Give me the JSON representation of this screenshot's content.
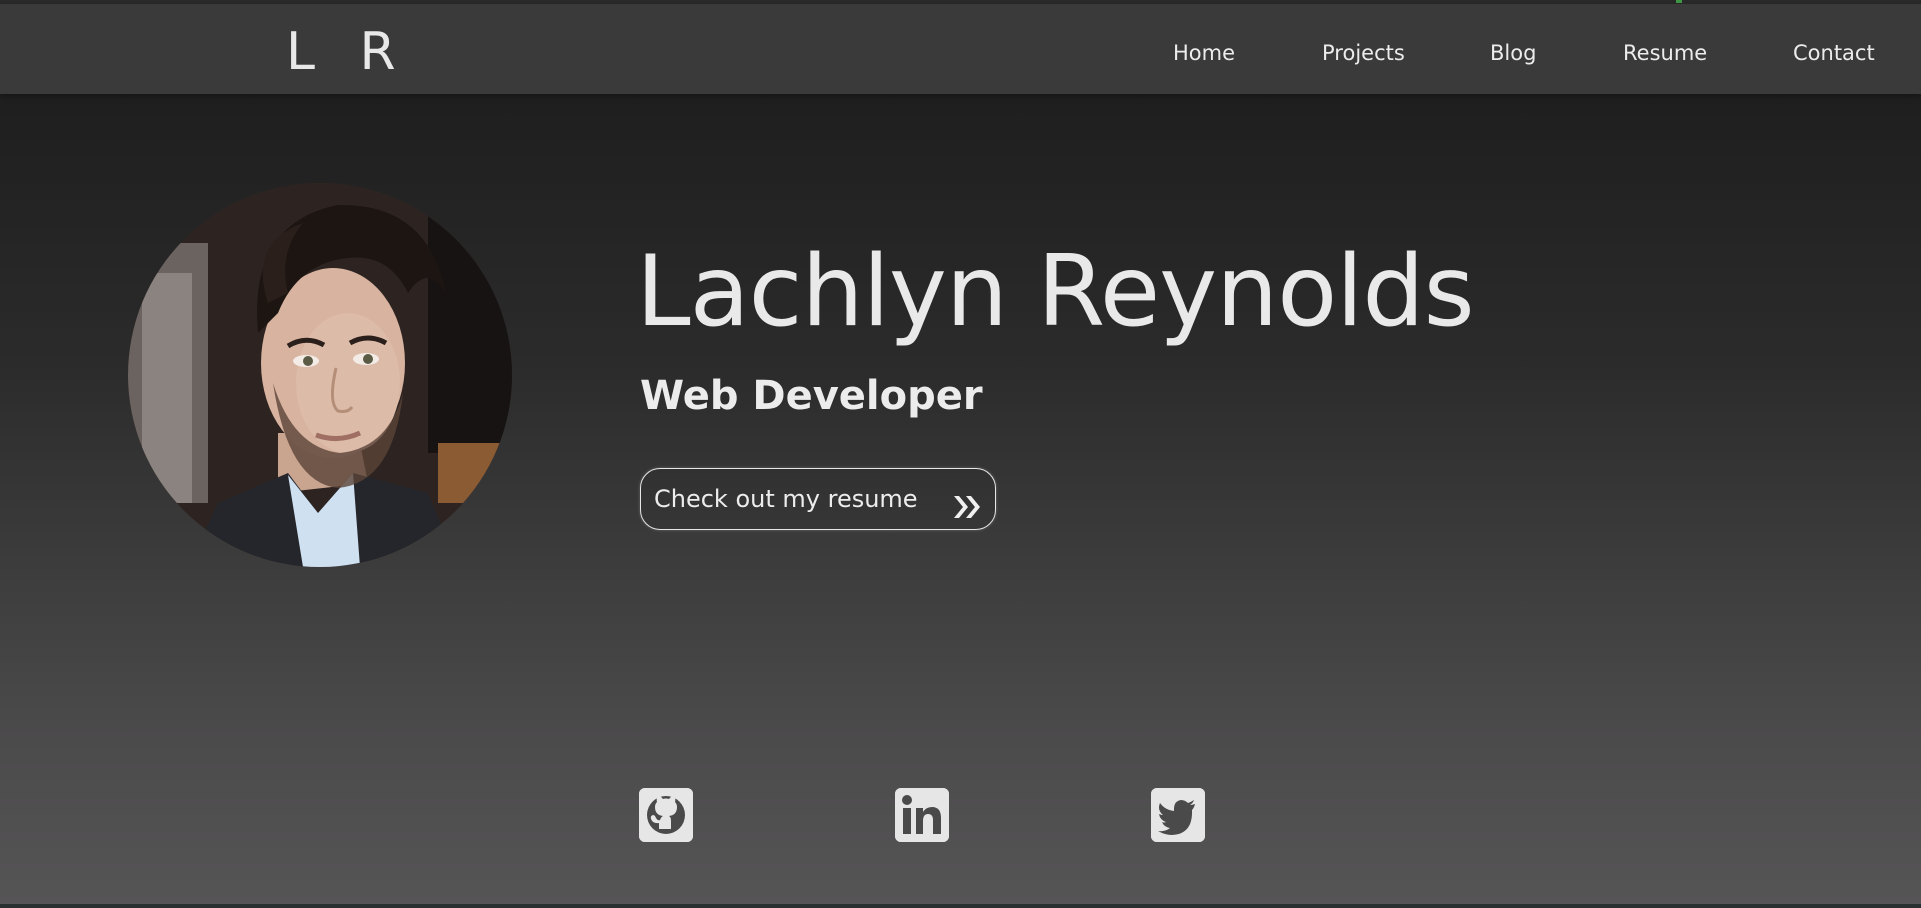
{
  "brand": {
    "logo_text": "L R"
  },
  "nav": {
    "items": [
      {
        "label": "Home"
      },
      {
        "label": "Projects"
      },
      {
        "label": "Blog"
      },
      {
        "label": "Resume"
      },
      {
        "label": "Contact"
      }
    ]
  },
  "hero": {
    "name": "Lachlyn Reynolds",
    "role": "Web Developer",
    "cta_label": "Check out my resume",
    "cta_icon": "double-chevron-right-icon",
    "avatar": "profile-photo"
  },
  "social": [
    {
      "icon": "github-icon"
    },
    {
      "icon": "linkedin-icon"
    },
    {
      "icon": "twitter-icon"
    }
  ],
  "colors": {
    "nav_bg": "#3a3a3a",
    "text": "#e9e9e9",
    "icon_bg": "#e6e6e6",
    "accent_dot": "#3f9b48"
  }
}
